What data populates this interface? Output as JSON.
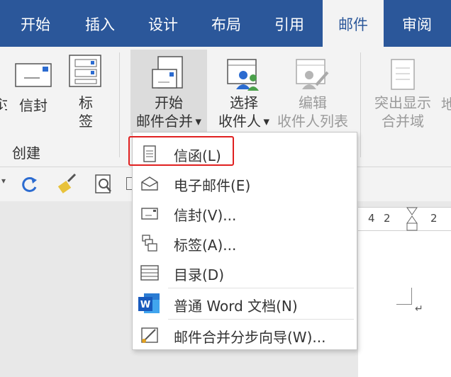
{
  "tabs": [
    {
      "label": "开始",
      "active": false
    },
    {
      "label": "插入",
      "active": false
    },
    {
      "label": "设计",
      "active": false
    },
    {
      "label": "布局",
      "active": false
    },
    {
      "label": "引用",
      "active": false
    },
    {
      "label": "邮件",
      "active": true
    },
    {
      "label": "审阅",
      "active": false
    }
  ],
  "ribbon": {
    "cut_left_text": "讨",
    "envelope": {
      "label": "信封"
    },
    "labels": {
      "line1": "标",
      "line2": "签"
    },
    "create_group_label": "创建",
    "start_merge": {
      "line1": "开始",
      "line2": "邮件合并"
    },
    "select_recipients": {
      "line1": "选择",
      "line2": "收件人"
    },
    "edit_recipients": {
      "line1": "编辑",
      "line2": "收件人列表"
    },
    "highlight_fields": {
      "line1": "突出显示",
      "line2": "合并域"
    },
    "cut_right_text": "地"
  },
  "ruler": {
    "tick_left": "4",
    "tick_mid": "2",
    "tick_right": "2"
  },
  "page": {
    "paragraph_mark": "↵"
  },
  "menu": {
    "items": [
      {
        "label": "信函(L)",
        "icon": "letter-icon"
      },
      {
        "label": "电子邮件(E)",
        "icon": "email-icon"
      },
      {
        "label": "信封(V)...",
        "icon": "envelope-icon"
      },
      {
        "label": "标签(A)...",
        "icon": "labels-icon"
      },
      {
        "label": "目录(D)",
        "icon": "directory-icon"
      },
      {
        "label": "普通 Word 文档(N)",
        "icon": "word-icon"
      },
      {
        "label": "邮件合并分步向导(W)...",
        "icon": "wizard-icon"
      }
    ]
  },
  "colors": {
    "accent": "#2b579a",
    "highlight": "#e02020",
    "word_blue": "#2b5fb4"
  }
}
